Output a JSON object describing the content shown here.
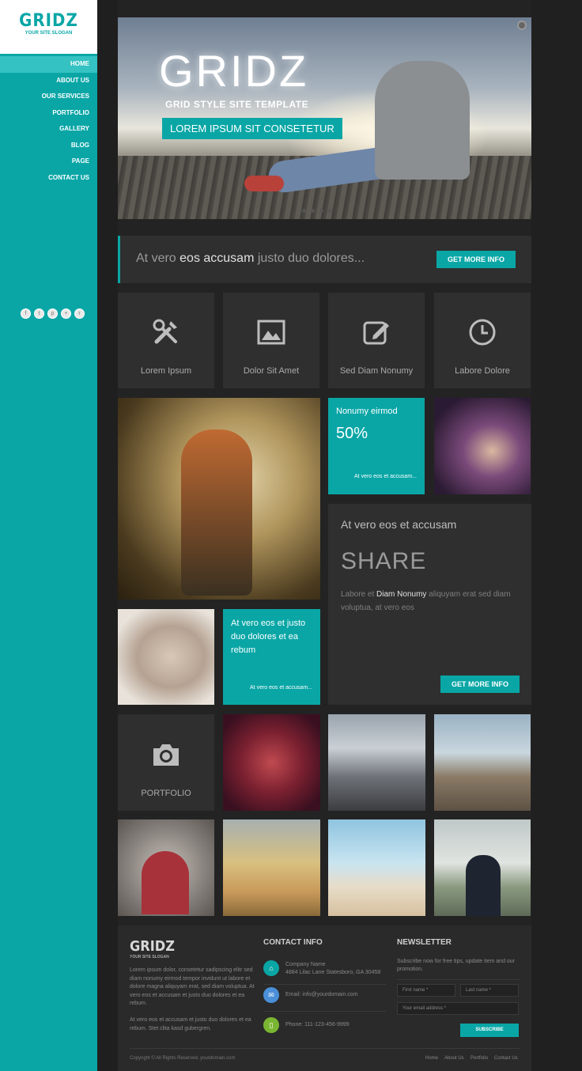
{
  "brand": {
    "name": "GRIDZ",
    "slogan": "YOUR SITE SLOGAN"
  },
  "nav": {
    "items": [
      "HOME",
      "ABOUT US",
      "OUR SERVICES",
      "PORTFOLIO",
      "GALLERY",
      "BLOG",
      "PAGE",
      "CONTACT US"
    ],
    "active": "HOME"
  },
  "social": [
    "f",
    "t",
    "p",
    "+",
    "r"
  ],
  "hero": {
    "title": "GRIDZ",
    "subtitle": "GRID STYLE SITE TEMPLATE",
    "cta": "LOREM IPSUM SIT CONSETETUR"
  },
  "callout": {
    "pre": "At vero ",
    "bold": "eos accusam",
    "post": " justo duo dolores...",
    "button": "GET MORE INFO"
  },
  "features": [
    {
      "label": "Lorem Ipsum",
      "icon": "tools-icon"
    },
    {
      "label": "Dolor Sit Amet",
      "icon": "image-icon"
    },
    {
      "label": "Sed Diam Nonumy",
      "icon": "edit-icon"
    },
    {
      "label": "Labore Dolore",
      "icon": "clock-icon"
    }
  ],
  "stat": {
    "title": "Nonumy eirmod",
    "value": "50%",
    "link": "At vero eos et accusam..."
  },
  "share": {
    "title": "At vero eos et accusam",
    "heading": "SHARE",
    "pre": "Labore et ",
    "bold": "Diam Nonumy",
    "post": " aliquyam erat sed diam voluptua, at vero eos",
    "button": "GET MORE INFO"
  },
  "promo": {
    "text": "At vero eos et justo duo dolores et ea rebum",
    "link": "At vero eos et accusam..."
  },
  "portfolio": {
    "label": "PORTFOLIO"
  },
  "footer": {
    "logo": "GRIDZ",
    "slogan": "YOUR SITE SLOGAN",
    "p1": "Lorem ipsum dolor, consetetur sadipscing elitr sed diam nonumy eirmod tempor invidunt ut labore et dolore magna aliquyam erat, sed diam voluptua. At vero eos et accusam et justo duo dolores et ea rebum.",
    "p2": "At vero eos et accusam et justo duo dolores et ea rebum. Stet clita kasd gubergren.",
    "contact_title": "CONTACT INFO",
    "company": "Company Name",
    "address": "4884 Lilac Lane Statesboro, GA 30458",
    "email": "Email: info@yourdomain.com",
    "phone": "Phone: 111-123-456-9999",
    "newsletter_title": "NEWSLETTER",
    "newsletter_text": "Subscribe now for free tips, update item and our promotion.",
    "first_name": "First name *",
    "last_name": "Last name *",
    "email_ph": "Your email address *",
    "subscribe": "SUBSCRIBE",
    "copyright": "Copyright © All Rights Reserved. yourdomain.com",
    "links": [
      "Home",
      "About Us",
      "Portfolio",
      "Contact Us"
    ]
  },
  "colors": {
    "accent": "#0aa6a6"
  }
}
